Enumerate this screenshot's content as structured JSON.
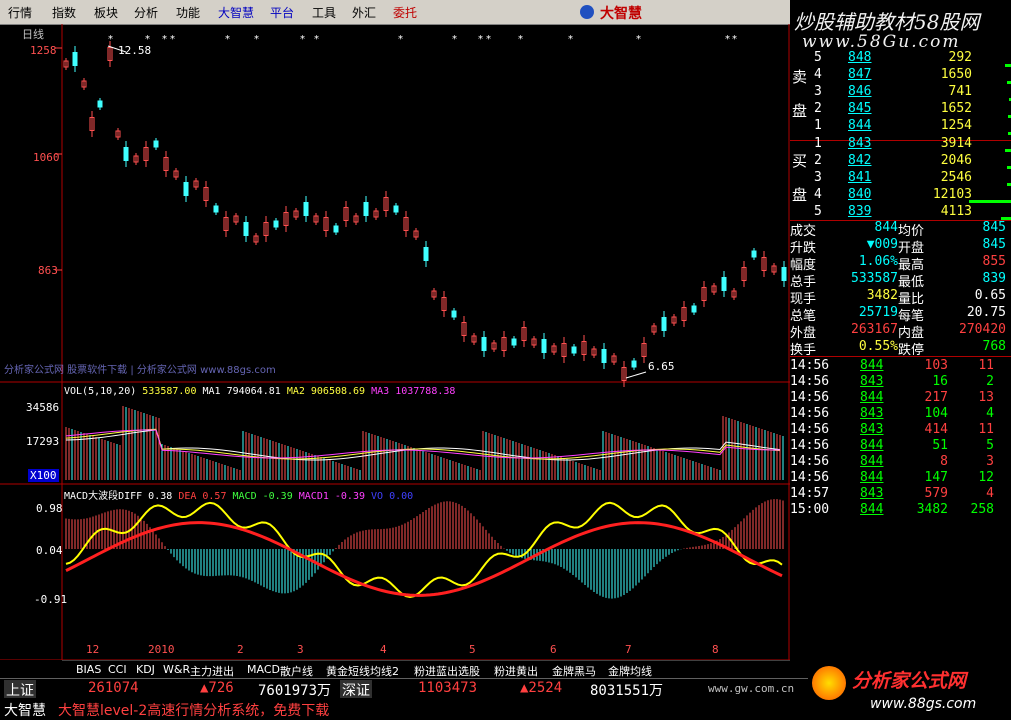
{
  "menu": {
    "items": [
      "行情",
      "指数",
      "板块",
      "分析",
      "功能",
      "大智慧",
      "平台",
      "工具",
      "外汇",
      "委托"
    ],
    "brand": "大智慧"
  },
  "watermark": {
    "line1": "炒股辅助教材58股网",
    "line2": "www.58Gu.com",
    "mid": "分析家公式网 股票软件下载 | 分析家公式网 www.88gs.com",
    "bottom_brand": "分析家公式网",
    "bottom_url": "www.88gs.com",
    "bottom_gw": "www.gw.com.cn"
  },
  "main_chart": {
    "period": "日线",
    "y_labels": [
      "1258",
      "1060",
      "863"
    ],
    "high_note": "12.58",
    "low_note": "6.65"
  },
  "vol_panel": {
    "title_main": "VOL(5,10,20)",
    "vol": "533587.00",
    "ma1": "MA1 794064.81",
    "ma2": "MA2 906508.69",
    "ma3": "MA3 1037788.38",
    "y_labels": [
      "34586",
      "17293",
      "X100"
    ]
  },
  "macd_panel": {
    "title": "MACD大波段DIFF 0.38",
    "dea": "DEA 0.57",
    "macd": "MACD -0.39",
    "macd1": "MACD1 -0.39",
    "vo": "VO 0.00",
    "y_labels": [
      "0.98",
      "0.04",
      "-0.91"
    ],
    "x_labels": [
      "12",
      "2010",
      "2",
      "3",
      "4",
      "5",
      "6",
      "7",
      "8"
    ]
  },
  "tabs": [
    "BIAS",
    "CCI",
    "KDJ",
    "W&R",
    "主力进出",
    "MACD",
    "散户线",
    "黄金短线均线2",
    "粉进蓝出选股",
    "粉进黄出",
    "金牌黑马",
    "金牌均线"
  ],
  "order_book": {
    "sell_label": [
      "卖",
      "盘"
    ],
    "buy_label": [
      "买",
      "盘"
    ],
    "sell": [
      {
        "n": "5",
        "p": "848",
        "v": "292"
      },
      {
        "n": "4",
        "p": "847",
        "v": "1650"
      },
      {
        "n": "3",
        "p": "846",
        "v": "741"
      },
      {
        "n": "2",
        "p": "845",
        "v": "1652"
      },
      {
        "n": "1",
        "p": "844",
        "v": "1254"
      }
    ],
    "buy": [
      {
        "n": "1",
        "p": "843",
        "v": "3914"
      },
      {
        "n": "2",
        "p": "842",
        "v": "2046"
      },
      {
        "n": "3",
        "p": "841",
        "v": "2546"
      },
      {
        "n": "4",
        "p": "840",
        "v": "12103"
      },
      {
        "n": "5",
        "p": "839",
        "v": "4113"
      }
    ]
  },
  "stats": [
    {
      "l1": "成交",
      "v1": "844",
      "l2": "均价",
      "v2": "845"
    },
    {
      "l1": "升跌",
      "v1": "▼009",
      "l2": "开盘",
      "v2": "845"
    },
    {
      "l1": "幅度",
      "v1": "1.06%",
      "l2": "最高",
      "v2": "855"
    },
    {
      "l1": "总手",
      "v1": "533587",
      "l2": "最低",
      "v2": "839"
    },
    {
      "l1": "现手",
      "v1": "3482",
      "l2": "量比",
      "v2": "0.65"
    },
    {
      "l1": "总笔",
      "v1": "25719",
      "l2": "每笔",
      "v2": "20.75"
    },
    {
      "l1": "外盘",
      "v1": "263167",
      "l2": "内盘",
      "v2": "270420"
    },
    {
      "l1": "换手",
      "v1": "0.55%",
      "l2": "跌停",
      "v2": "768"
    }
  ],
  "ticks": [
    {
      "t": "14:56",
      "p": "844",
      "v": "103",
      "n": "11"
    },
    {
      "t": "14:56",
      "p": "843",
      "v": "16",
      "n": "2"
    },
    {
      "t": "14:56",
      "p": "844",
      "v": "217",
      "n": "13"
    },
    {
      "t": "14:56",
      "p": "843",
      "v": "104",
      "n": "4"
    },
    {
      "t": "14:56",
      "p": "843",
      "v": "414",
      "n": "11"
    },
    {
      "t": "14:56",
      "p": "844",
      "v": "51",
      "n": "5"
    },
    {
      "t": "14:56",
      "p": "844",
      "v": "8",
      "n": "3"
    },
    {
      "t": "14:56",
      "p": "844",
      "v": "147",
      "n": "12"
    },
    {
      "t": "14:57",
      "p": "843",
      "v": "579",
      "n": "4"
    },
    {
      "t": "15:00",
      "p": "844",
      "v": "3482",
      "n": "258"
    }
  ],
  "status": {
    "sh_label": "上证",
    "sh_value": "261074",
    "sh_change": "▲726",
    "sh_amount": "7601973万",
    "sz_label": "深证",
    "sz_value": "1103473",
    "sz_change": "▲2524",
    "sz_amount": "8031551万",
    "app": "大智慧",
    "ad": "大智慧level-2高速行情分析系统，免费下载"
  },
  "colors": {
    "up": "#ff5050",
    "down": "#40ffff",
    "price_cyan": "#00ffff",
    "accent_red": "#ff0000",
    "green": "#00ff00",
    "yellow": "#ffff00"
  }
}
